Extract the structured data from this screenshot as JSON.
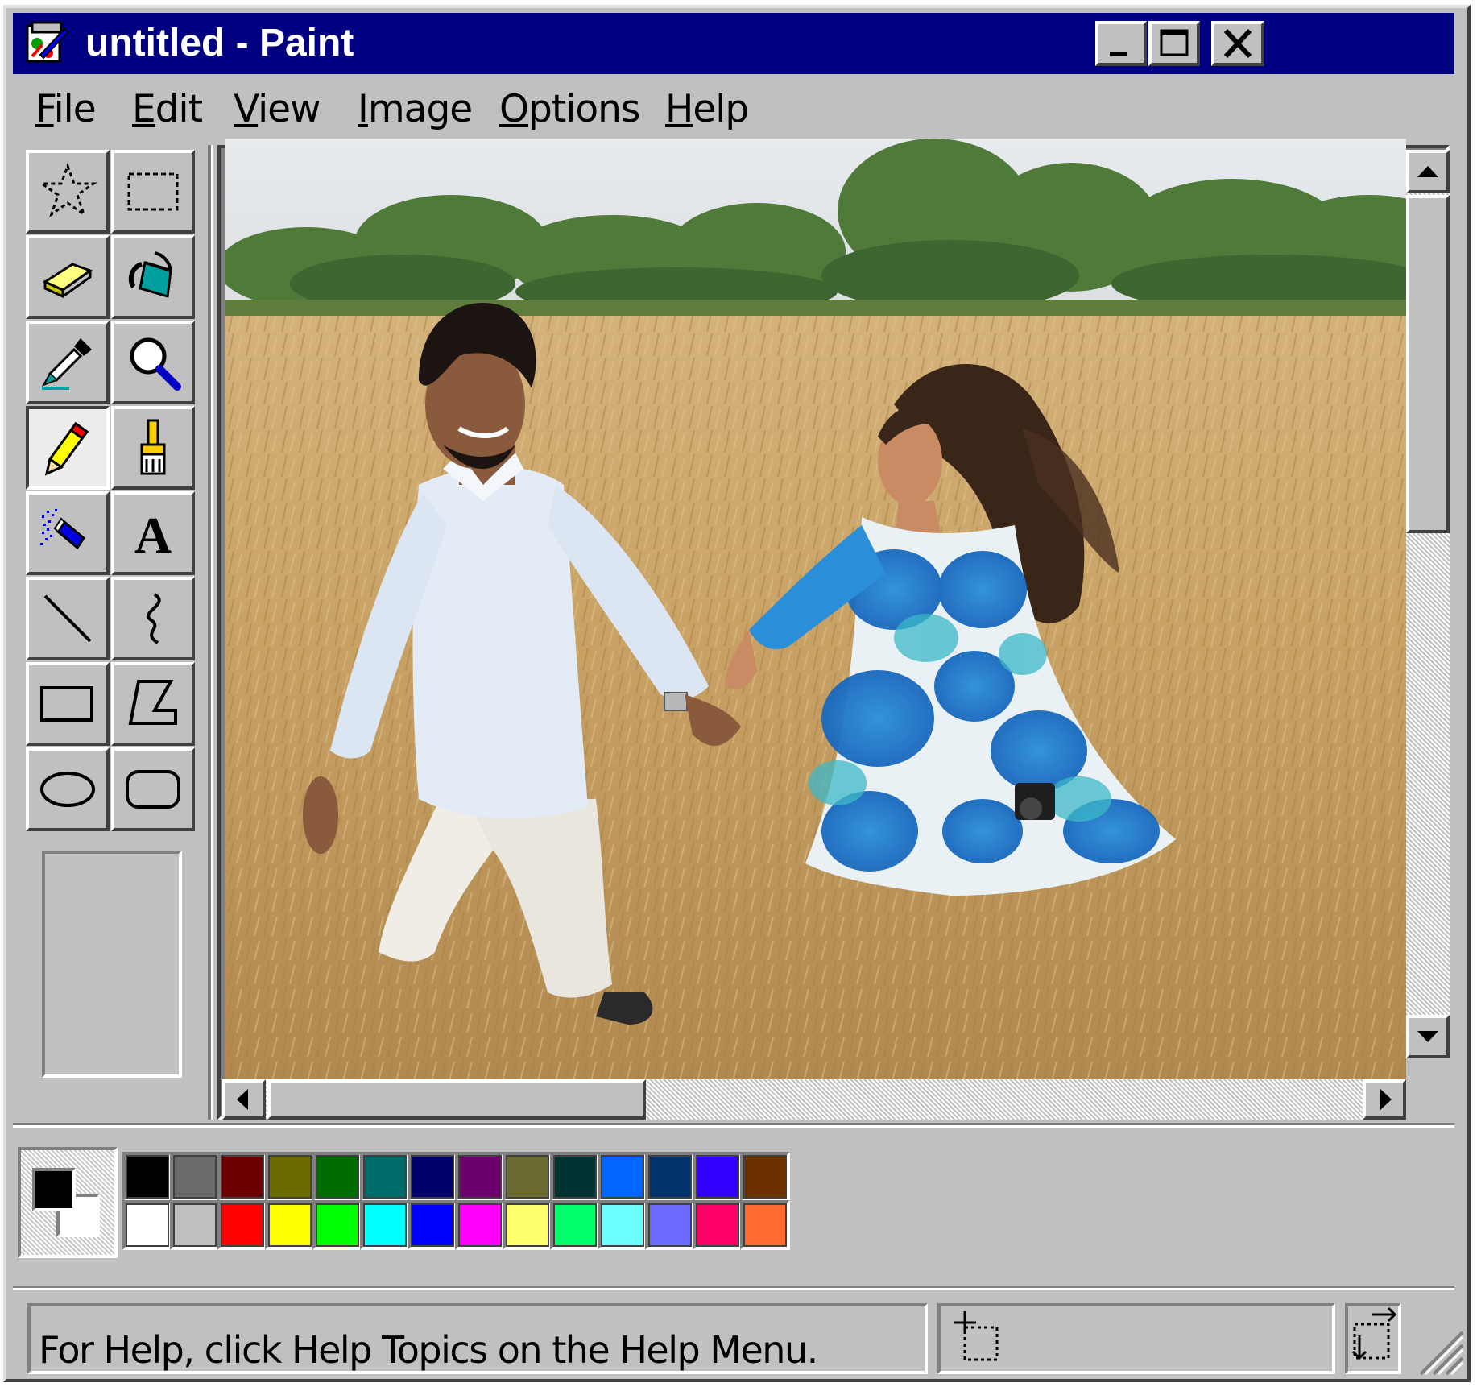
{
  "window": {
    "title": "untitled - Paint",
    "app_icon": "paint-palette-icon",
    "buttons": {
      "minimize_icon": "minimize-icon",
      "maximize_icon": "maximize-icon",
      "close_icon": "close-icon"
    }
  },
  "menu": {
    "items": [
      {
        "label": "File",
        "mnemonic": "F"
      },
      {
        "label": "Edit",
        "mnemonic": "E"
      },
      {
        "label": "View",
        "mnemonic": "V"
      },
      {
        "label": "Image",
        "mnemonic": "I"
      },
      {
        "label": "Options",
        "mnemonic": "O"
      },
      {
        "label": "Help",
        "mnemonic": "H"
      }
    ]
  },
  "tools": [
    {
      "name": "free-form-select",
      "icon": "star-select-icon"
    },
    {
      "name": "select",
      "icon": "rect-select-icon"
    },
    {
      "name": "eraser",
      "icon": "eraser-icon"
    },
    {
      "name": "fill-with-color",
      "icon": "paint-bucket-icon"
    },
    {
      "name": "pick-color",
      "icon": "eyedropper-icon"
    },
    {
      "name": "magnifier",
      "icon": "magnifier-icon"
    },
    {
      "name": "pencil",
      "icon": "pencil-icon",
      "selected": true
    },
    {
      "name": "brush",
      "icon": "brush-icon"
    },
    {
      "name": "airbrush",
      "icon": "airbrush-icon"
    },
    {
      "name": "text",
      "icon": "text-tool-icon"
    },
    {
      "name": "line",
      "icon": "line-icon"
    },
    {
      "name": "curve",
      "icon": "curve-icon"
    },
    {
      "name": "rectangle",
      "icon": "rectangle-icon"
    },
    {
      "name": "polygon",
      "icon": "polygon-icon"
    },
    {
      "name": "ellipse",
      "icon": "ellipse-icon"
    },
    {
      "name": "rounded-rectangle",
      "icon": "rounded-rectangle-icon"
    }
  ],
  "canvas": {
    "content": "photo",
    "image_icon": "photo-couple-wheat-field"
  },
  "colors": {
    "foreground": "#000000",
    "background": "#ffffff",
    "palette_top": [
      "#000000",
      "#6b6b6b",
      "#6b0000",
      "#6b6b00",
      "#006b00",
      "#006b6b",
      "#00006b",
      "#6b006b",
      "#6b6b32",
      "#003232",
      "#0066ff",
      "#00326b",
      "#3200ff",
      "#6b3200"
    ],
    "palette_bottom": [
      "#ffffff",
      "#bfbfbf",
      "#ff0000",
      "#ffff00",
      "#00ff00",
      "#00ffff",
      "#0000ff",
      "#ff00ff",
      "#ffff6b",
      "#00ff6b",
      "#6bffff",
      "#6b6bff",
      "#ff0066",
      "#ff6b32"
    ]
  },
  "status": {
    "help_text": "For Help, click Help Topics on the Help Menu.",
    "position_icon": "cursor-position-icon",
    "size_icon": "selection-size-icon"
  },
  "theme": {
    "face": "#c0c0c0",
    "title_bar": "#000080",
    "title_text": "#ffffff"
  }
}
